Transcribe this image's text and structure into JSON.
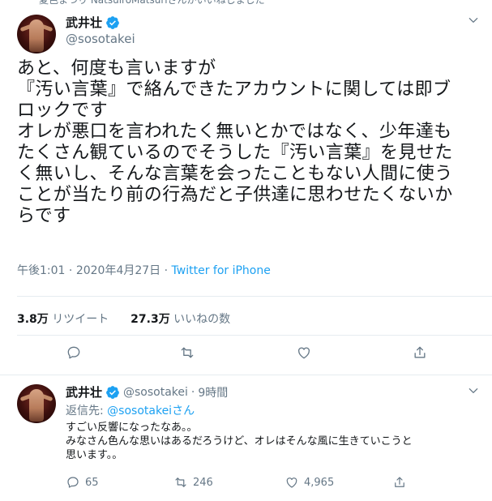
{
  "retweet_context": {
    "text": "夏色まつり NatsuiroMatsuriさんがいいねしました"
  },
  "main_tweet": {
    "author_name": "武井壮",
    "author_handle": "@sosotakei",
    "body_lines": [
      "あと、何度も言いますが",
      "『汚い言葉』で絡んできたアカウントに関しては即ブ",
      "ロックです",
      "オレが悪口を言われたく無いとかではなく、少年達も",
      "たくさん観ているのでそうした『汚い言葉』を見せた",
      "く無いし、そんな言葉を会ったこともない人間に使う",
      "ことが当たり前の行為だと子供達に思わせたくないか",
      "らです"
    ],
    "time": "午後1:01",
    "separator": "·",
    "date": "2020年4月27日",
    "source": "Twitter for iPhone",
    "retweet_count": "3.8万",
    "retweet_label": "リツイート",
    "like_count": "27.3万",
    "like_label": "いいねの数"
  },
  "reply_tweet": {
    "author_name": "武井壮",
    "author_handle": "@sosotakei",
    "separator": "·",
    "time_ago": "9時間",
    "reply_to_label": "返信先:",
    "reply_to_handle": "@sosotakei",
    "reply_to_suffix": "さん",
    "body_lines": [
      "すごい反響になったなあ。。",
      "みなさん色んな思いはあるだろうけど、オレはそんな風に生きていこうと",
      "思います。。"
    ],
    "reply_count": "65",
    "retweet_count": "246",
    "like_count": "4,965"
  },
  "colors": {
    "accent": "#1da1f2",
    "secondary_text": "#657786",
    "divider": "#e6ecf0"
  }
}
